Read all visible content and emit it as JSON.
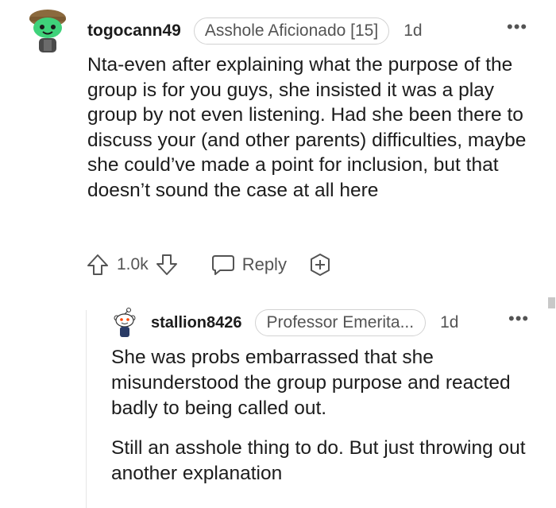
{
  "comment": {
    "username": "togocann49",
    "flair": "Asshole Aficionado [15]",
    "age": "1d",
    "more": "•••",
    "body": "Nta-even after explaining what the purpose of the group is for you guys, she insisted it was a play group by not even listening. Had she been there to discuss your (and other parents) difficulties, maybe she could’ve made a point for inclusion, but that doesn’t sound the case at all here",
    "vote_count": "1.0k",
    "reply_label": "Reply",
    "avatar_color": "#3fd27a"
  },
  "reply": {
    "username": "stallion8426",
    "flair": "Professor Emerita...",
    "age": "1d",
    "more": "•••",
    "paragraphs": [
      "She was probs embarrassed that she misunderstood the group purpose and reacted badly to being called out.",
      "Still an asshole thing to do. But just throwing out another explanation"
    ]
  },
  "icons": [
    "snoo-avatar-icon",
    "upvote-icon",
    "downvote-icon",
    "reply-icon",
    "award-icon",
    "more-options-icon"
  ]
}
